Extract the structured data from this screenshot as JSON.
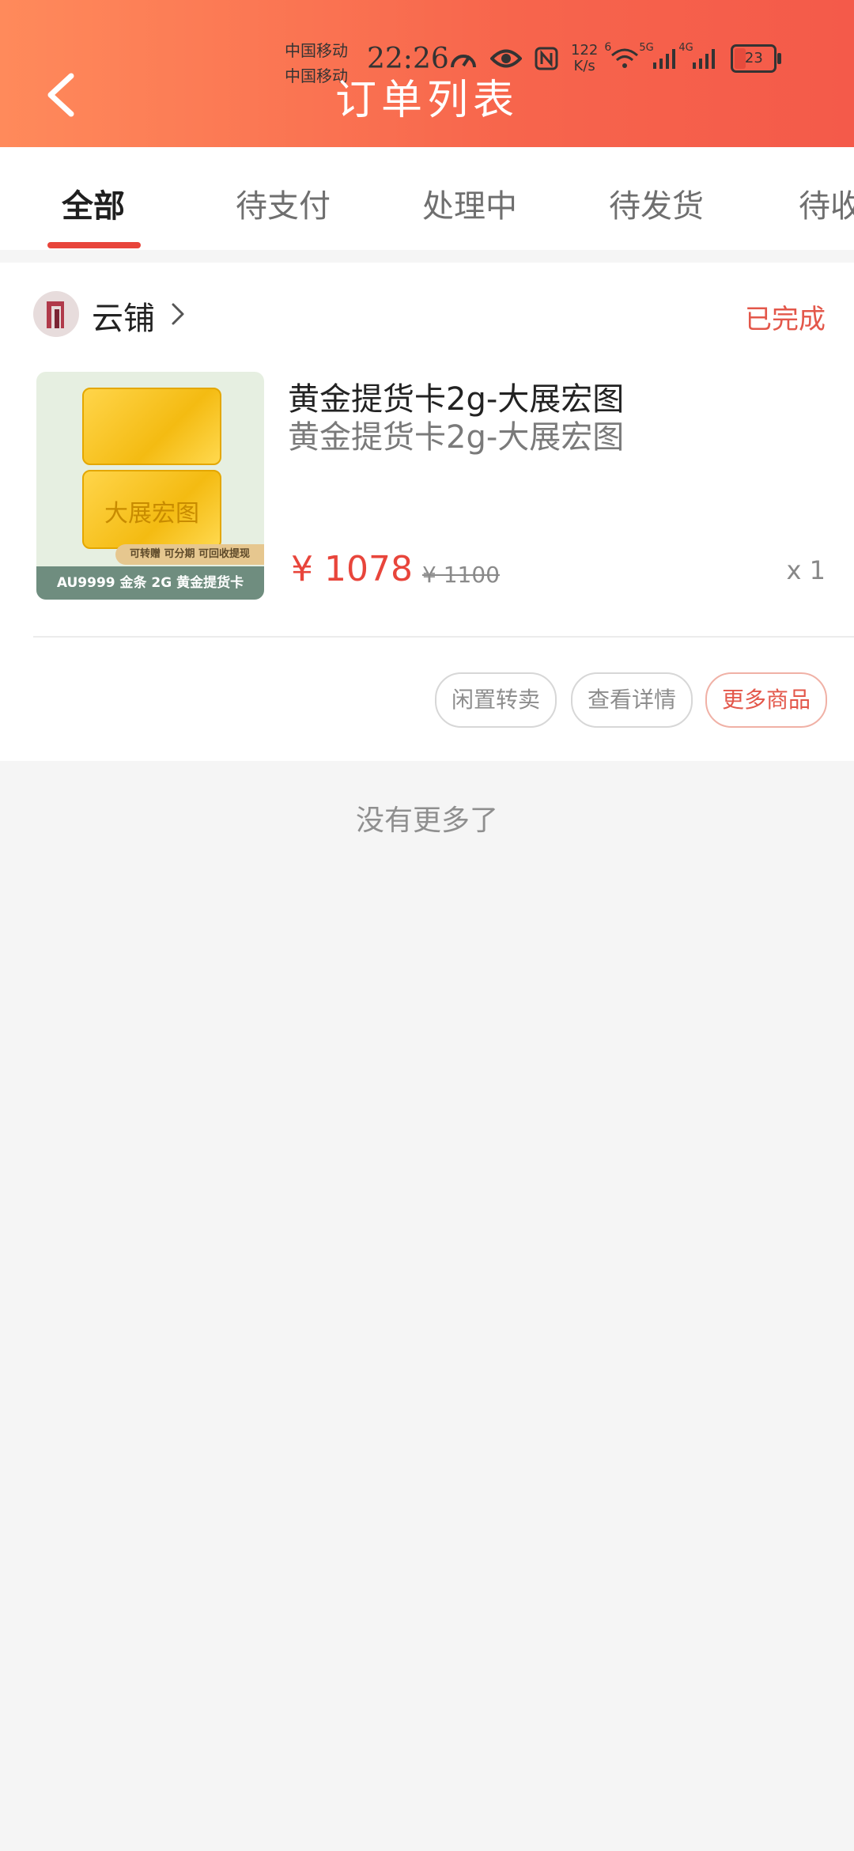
{
  "status_bar": {
    "carrier_1": "中国移动",
    "carrier_2": "中国移动",
    "time": "22:26",
    "net_speed_value": "122",
    "net_speed_unit": "K/s",
    "signal_1_label": "5G",
    "signal_2_label": "4G",
    "wifi_label": "6",
    "battery": "23",
    "icons": [
      "speedometer-icon",
      "eye-icon",
      "nfc-icon",
      "wifi-icon",
      "signal-icon",
      "battery-icon"
    ]
  },
  "header": {
    "title": "订单列表",
    "back_icon": "chevron-left-icon"
  },
  "tabs": [
    {
      "label": "全部",
      "active": true
    },
    {
      "label": "待支付"
    },
    {
      "label": "处理中"
    },
    {
      "label": "待发货"
    },
    {
      "label": "待收"
    }
  ],
  "order": {
    "shop_name": "云铺",
    "status": "已完成",
    "product": {
      "title": "黄金提货卡2g-大展宏图",
      "subtitle": "黄金提货卡2g-大展宏图",
      "price": "¥ 1078",
      "original_price": "¥ 1100",
      "quantity": "x 1",
      "image_bar_text": "大展宏图",
      "image_tag": "可转赠 可分期 可回收提现",
      "image_caption": "AU9999 金条 2G  黄金提货卡"
    },
    "actions": [
      "闲置转卖",
      "查看详情",
      "更多商品"
    ]
  },
  "footer_text": "没有更多了",
  "colors": {
    "accent": "#e8453b",
    "header_start": "#ff8a5b",
    "header_end": "#f45a4a"
  }
}
